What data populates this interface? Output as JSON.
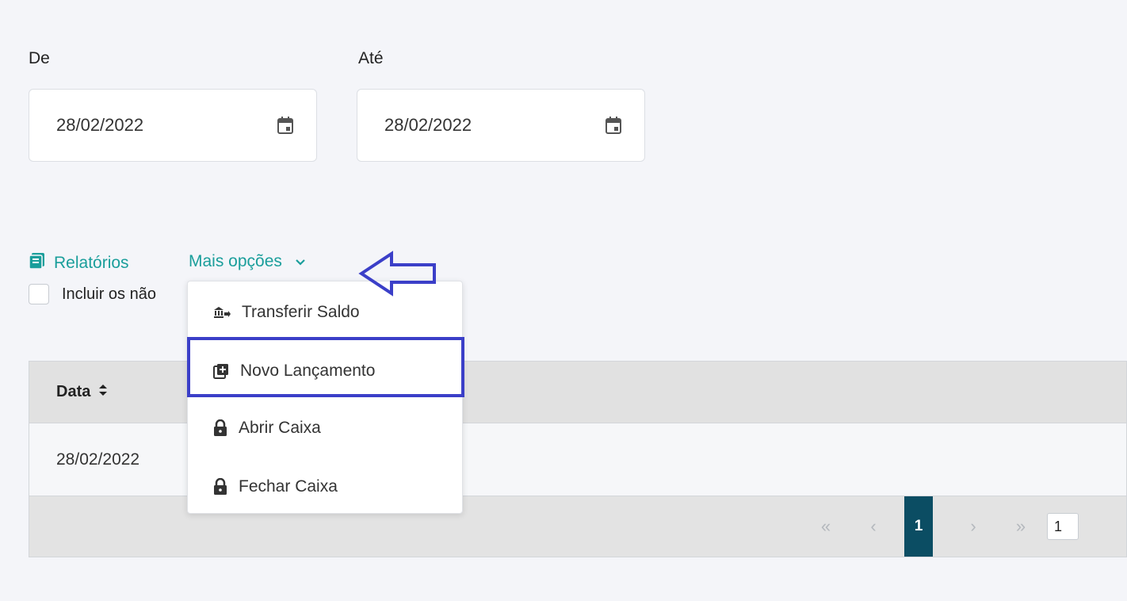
{
  "filters": {
    "from_label": "De",
    "from_value": "28/02/2022",
    "to_label": "Até",
    "to_value": "28/02/2022"
  },
  "toolbar": {
    "reports_label": "Relatórios",
    "more_options_label": "Mais opções"
  },
  "checkbox_label": "Incluir os não",
  "table": {
    "header_date": "Data",
    "rows": [
      "28/02/2022"
    ]
  },
  "pagination": {
    "first": "«",
    "prev": "‹",
    "current_page": "1",
    "next": "›",
    "last": "»",
    "page_size": "1"
  },
  "dropdown": {
    "items": [
      {
        "label": "Transferir Saldo",
        "icon": "bank-transfer-icon"
      },
      {
        "label": "Novo Lançamento",
        "icon": "library-add-icon"
      },
      {
        "label": "Abrir Caixa",
        "icon": "lock-icon"
      },
      {
        "label": "Fechar Caixa",
        "icon": "lock-icon"
      }
    ]
  },
  "colors": {
    "accent": "#1a9e9b",
    "pager_active": "#0b4d63",
    "annotation": "#3b3fc8"
  }
}
